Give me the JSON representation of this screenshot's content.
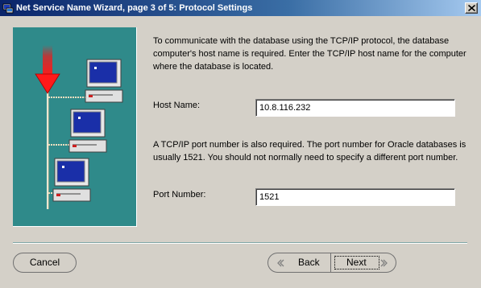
{
  "window": {
    "title": "Net Service Name Wizard, page 3 of 5: Protocol Settings"
  },
  "content": {
    "description_1": "To communicate with the database using the TCP/IP protocol, the database computer's host name is required.  Enter the TCP/IP host name for the computer where the database is located.",
    "host_label": "Host Name:",
    "host_value": "10.8.116.232",
    "description_2": "A TCP/IP port number is also required.  The port number for Oracle databases is usually 1521.  You should not normally need to specify a different port number.",
    "port_label": "Port Number:",
    "port_value": "1521"
  },
  "buttons": {
    "cancel": "Cancel",
    "back": "Back",
    "next": "Next"
  },
  "colors": {
    "graphic_background": "#2f8a8a",
    "title_bar": "#0a246a",
    "dialog_background": "#d4d0c8"
  },
  "icons": [
    "wizard-app-icon",
    "close-icon",
    "network-computers-illustration",
    "red-arrow-down-icon",
    "chevron-left-icon",
    "chevron-right-icon"
  ]
}
